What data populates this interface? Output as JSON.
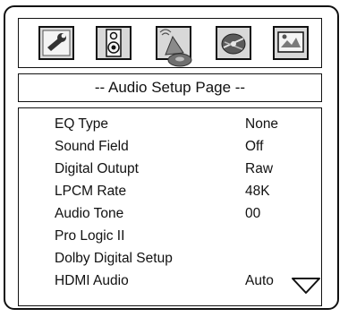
{
  "toolbar": {
    "icons": [
      {
        "name": "general-setup-icon"
      },
      {
        "name": "audio-setup-icon"
      },
      {
        "name": "video-setup-icon"
      },
      {
        "name": "speaker-setup-icon"
      },
      {
        "name": "preferences-icon"
      }
    ]
  },
  "page": {
    "title": "-- Audio Setup Page --"
  },
  "menu": {
    "items": [
      {
        "label": "EQ Type",
        "value": "None"
      },
      {
        "label": "Sound Field",
        "value": "Off"
      },
      {
        "label": "Digital Outupt",
        "value": "Raw"
      },
      {
        "label": "LPCM Rate",
        "value": "48K"
      },
      {
        "label": "Audio Tone",
        "value": "00"
      },
      {
        "label": "Pro Logic II",
        "value": ""
      },
      {
        "label": "Dolby Digital Setup",
        "value": ""
      },
      {
        "label": "HDMI Audio",
        "value": "Auto"
      }
    ]
  },
  "colors": {
    "icon_fill": "#d8d8d8",
    "icon_border": "#111111",
    "icon_accent": "#7a7a7a"
  }
}
